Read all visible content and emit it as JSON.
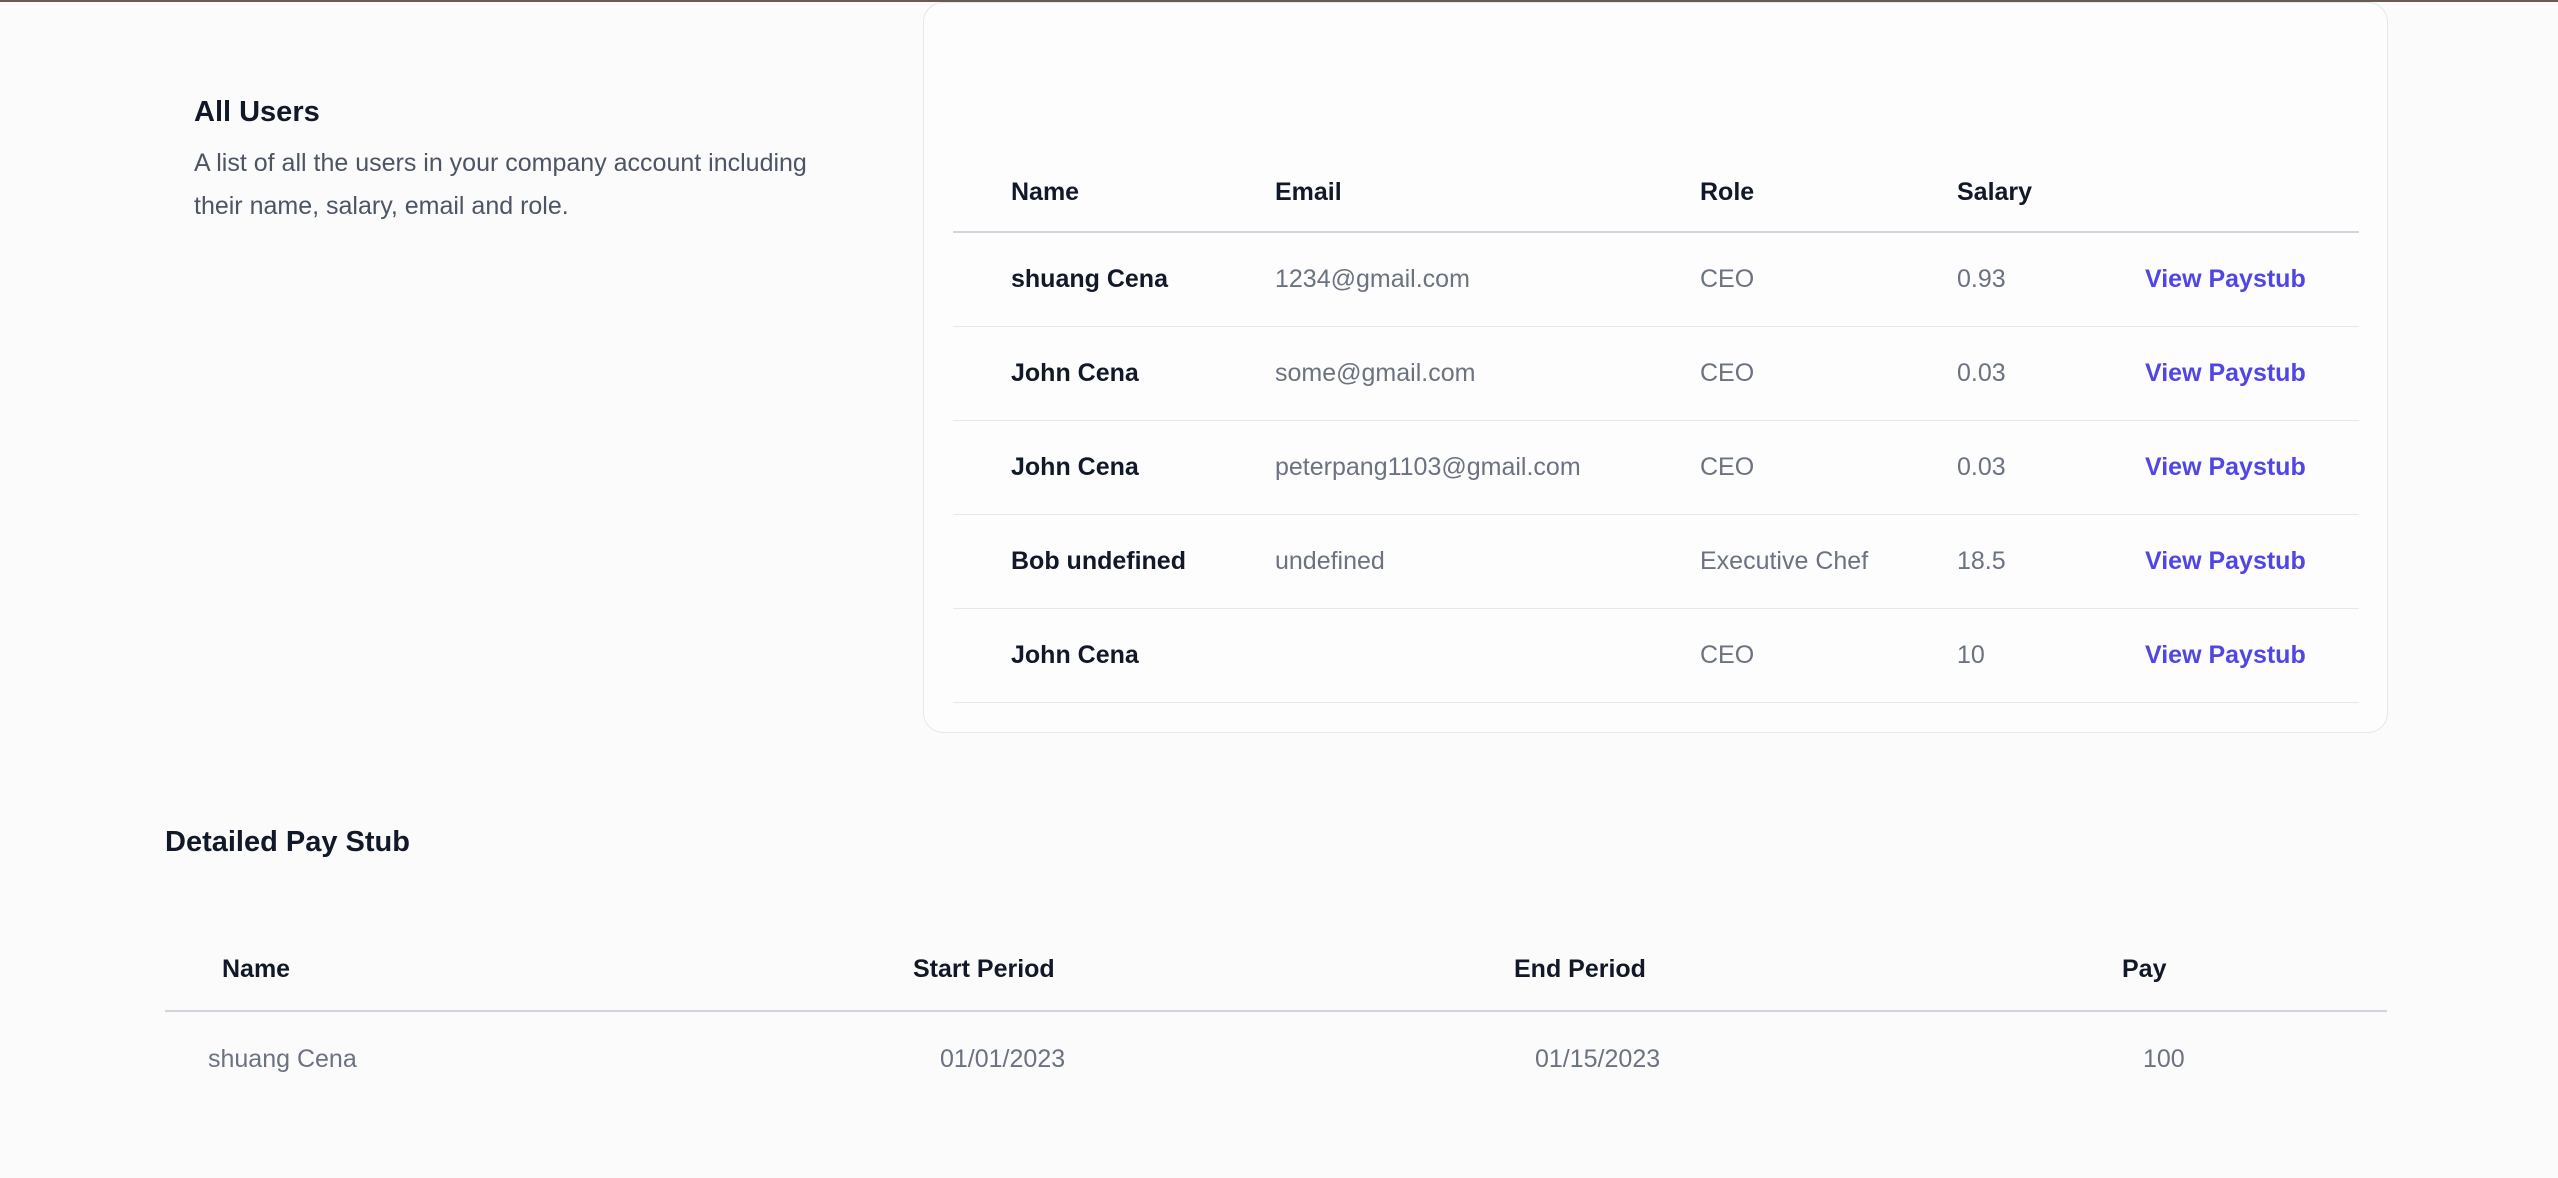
{
  "users_section": {
    "title": "All Users",
    "description": "A list of all the users in your company account including their name, salary, email and role."
  },
  "users_table": {
    "headers": {
      "name": "Name",
      "email": "Email",
      "role": "Role",
      "salary": "Salary"
    },
    "rows": [
      {
        "name": "shuang Cena",
        "email": "1234@gmail.com",
        "role": "CEO",
        "salary": "0.93",
        "action": "View Paystub"
      },
      {
        "name": "John Cena",
        "email": "some@gmail.com",
        "role": "CEO",
        "salary": "0.03",
        "action": "View Paystub"
      },
      {
        "name": "John Cena",
        "email": "peterpang1103@gmail.com",
        "role": "CEO",
        "salary": "0.03",
        "action": "View Paystub"
      },
      {
        "name": "Bob undefined",
        "email": "undefined",
        "role": "Executive Chef",
        "salary": "18.5",
        "action": "View Paystub"
      },
      {
        "name": "John Cena",
        "email": "",
        "role": "CEO",
        "salary": "10",
        "action": "View Paystub"
      }
    ]
  },
  "pay_stub": {
    "title": "Detailed Pay Stub",
    "headers": {
      "name": "Name",
      "start": "Start Period",
      "end": "End Period",
      "pay": "Pay"
    },
    "rows": [
      {
        "name": "shuang Cena",
        "start": "01/01/2023",
        "end": "01/15/2023",
        "pay": "100"
      }
    ]
  },
  "colors": {
    "link": "#4f46e5",
    "heading": "#111827",
    "muted": "#6b7280",
    "border": "#e5e7eb"
  }
}
